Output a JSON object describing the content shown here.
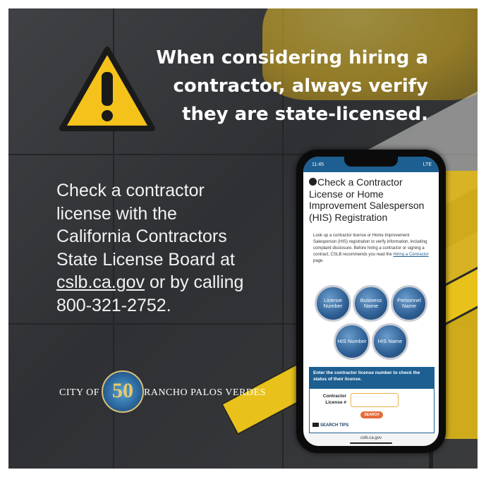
{
  "headline": {
    "line1": "When considering hiring a",
    "line2": "contractor, always verify",
    "line3": "they are state-licensed."
  },
  "body": {
    "line1": "Check a contractor",
    "line2": "license with the",
    "line3": "California Contractors",
    "line4": "State License Board at",
    "link": "cslb.ca.gov",
    "line5_rest": " or by calling",
    "phone": "800-321-2752."
  },
  "city": {
    "city_of": "CITY OF",
    "seal_number": "50",
    "name": "RANCHO PALOS VERDES"
  },
  "phone_screen": {
    "time": "11:45",
    "signal": "LTE",
    "title": "Check a Contractor License or Home Improvement Salesperson (HIS) Registration",
    "description": "Look up a contractor license or Home Improvement Salesperson (HIS) registration to verify information, including complaint disclosure. Before hiring a contractor or signing a contract, CSLB recommends you read the ",
    "description_link": "Hiring a Contractor",
    "description_end": " page.",
    "buttons": [
      "License Number",
      "Business Name",
      "Personnel Name",
      "HIS Number",
      "HIS Name"
    ],
    "search_heading": "Enter the contractor license number to check the status of their license.",
    "field_label": "Contractor License #",
    "search_button": "SEARCH",
    "tips": "SEARCH TIPS",
    "url": "cslb.ca.gov"
  },
  "colors": {
    "warning_yellow": "#f4c21a",
    "accent_blue": "#1d5f91",
    "search_orange": "#e56a3a"
  }
}
